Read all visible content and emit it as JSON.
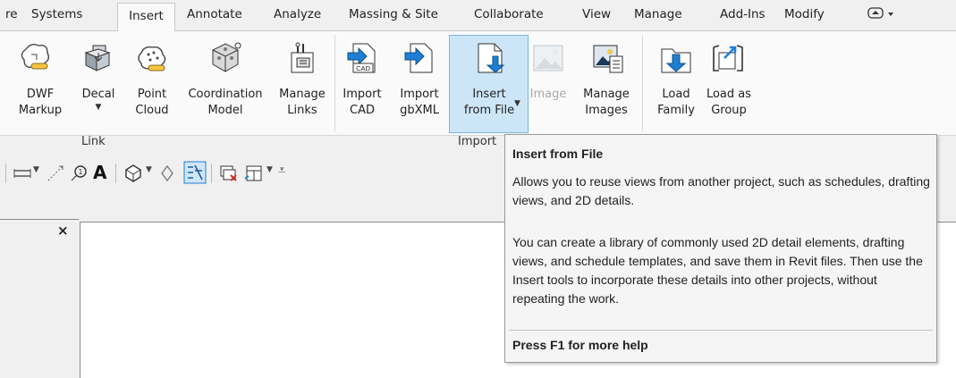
{
  "tabs": [
    "re",
    "Systems",
    "Insert",
    "Annotate",
    "Analyze",
    "Massing & Site",
    "Collaborate",
    "View",
    "Manage",
    "Add-Ins",
    "Modify"
  ],
  "active_tab": "Insert",
  "ribbon": {
    "tools": [
      {
        "line1": "DWF",
        "line2": "Markup",
        "icon": "dwf-markup-icon"
      },
      {
        "line1": "Decal",
        "line2": "",
        "dropdown": true,
        "icon": "decal-icon"
      },
      {
        "line1": "Point",
        "line2": "Cloud",
        "icon": "point-cloud-icon"
      },
      {
        "line1": "Coordination",
        "line2": "Model",
        "icon": "coordination-model-icon"
      },
      {
        "line1": "Manage",
        "line2": "Links",
        "icon": "manage-links-icon"
      },
      {
        "line1": "Import",
        "line2": "CAD",
        "icon": "import-cad-icon"
      },
      {
        "line1": "Import",
        "line2": "gbXML",
        "icon": "import-gbxml-icon"
      },
      {
        "line1": "Insert",
        "line2": "from File",
        "dropdown": true,
        "icon": "insert-from-file-icon"
      },
      {
        "line1": "Image",
        "line2": "",
        "disabled": true,
        "icon": "image-icon"
      },
      {
        "line1": "Manage",
        "line2": "Images",
        "icon": "manage-images-icon"
      },
      {
        "line1": "Load",
        "line2": "Family",
        "icon": "load-family-icon"
      },
      {
        "line1": "Load as",
        "line2": "Group",
        "icon": "load-as-group-icon"
      }
    ],
    "panels": {
      "link": "Link",
      "import": "Import"
    },
    "cad_badge": "CAD"
  },
  "tooltip": {
    "title": "Insert from File",
    "p1": "Allows you to reuse views from another project, such as schedules, drafting views, and 2D details.",
    "p2": "You can create a library of commonly used 2D detail elements, drafting views, and schedule templates, and save them in Revit files. Then use the Insert tools to incorporate these details into other projects, without repeating the work.",
    "footer": "Press F1 for more help"
  },
  "close_glyph": "×",
  "qat_icons": [
    "align-dimension-icon",
    "measure-icon",
    "tag-icon",
    "text-icon",
    "3d-view-icon",
    "section-icon",
    "thin-lines-icon",
    "close-hidden-icon",
    "switch-windows-icon",
    "customize-icon"
  ]
}
